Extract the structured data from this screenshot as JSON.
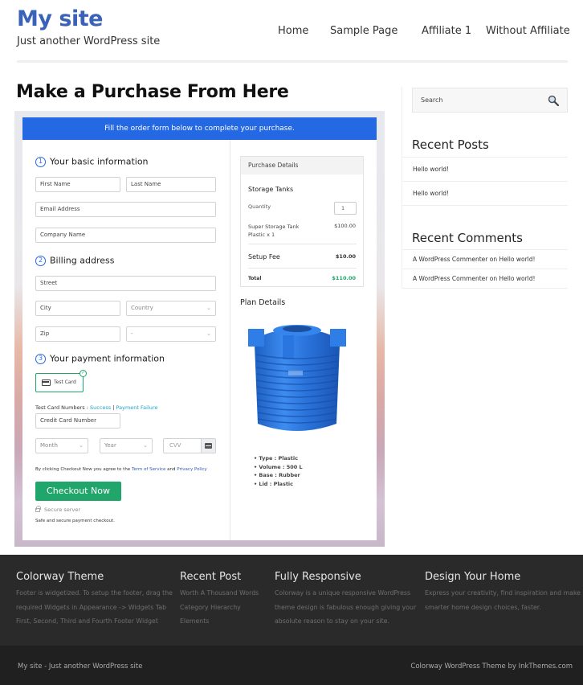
{
  "header": {
    "site_title": "My site",
    "tagline": "Just another WordPress site",
    "nav": [
      "Home",
      "Sample Page",
      "Affiliate 1",
      "Without Affiliate"
    ]
  },
  "main": {
    "page_title": "Make a Purchase From Here",
    "order_form": {
      "banner": "Fill the order form below to complete your purchase.",
      "steps": [
        {
          "num": "1",
          "label": "Your basic information"
        },
        {
          "num": "2",
          "label": "Billing address"
        },
        {
          "num": "3",
          "label": "Your payment information"
        }
      ],
      "fields": {
        "first_name": "First Name",
        "last_name": "Last Name",
        "email": "Email Address",
        "company": "Company Name",
        "street": "Street",
        "city": "City",
        "country": "Country",
        "zip": "Zip",
        "state": "-",
        "card_number": "Credit Card Number",
        "month": "Month",
        "year": "Year",
        "cvv": "CVV"
      },
      "payment_option": "Test Card",
      "test_card_label": "Test Card Numbers :",
      "test_success": "Success",
      "test_sep": "|",
      "test_failure": "Payment Failure",
      "agree_prefix": "By clicking Checkout Now you agree to the",
      "terms": "Term of Service",
      "and": "and",
      "privacy": "Privacy Policy",
      "checkout_button": "Checkout Now",
      "secure_server": "Secure server",
      "safe_text": "Safe and secure payment checkout."
    },
    "purchase_details": {
      "heading": "Purchase Details",
      "product": "Storage Tanks",
      "quantity_label": "Quantity",
      "quantity": "1",
      "item_line1": "Super Storage Tank",
      "item_line2": "Plastic x 1",
      "item_price": "$100.00",
      "setup_fee_label": "Setup Fee",
      "setup_fee": "$10.00",
      "total_label": "Total",
      "total": "$110.00"
    },
    "plan_details": {
      "heading": "Plan Details",
      "specs": [
        "Type : Plastic",
        "Volume : 500 L",
        "Base : Rubber",
        "Lid : Plastic"
      ]
    }
  },
  "sidebar": {
    "search_placeholder": "Search",
    "recent_posts_title": "Recent Posts",
    "recent_posts": [
      "Hello world!",
      "Hello world!"
    ],
    "recent_comments_title": "Recent Comments",
    "recent_comments": [
      "A WordPress Commenter on Hello world!",
      "A WordPress Commenter on Hello world!"
    ]
  },
  "footer": {
    "columns": [
      {
        "title": "Colorway Theme",
        "lines": [
          "Footer is widgetized. To setup the footer, drag the",
          "required Widgets in Appearance -> Widgets Tab",
          "First, Second, Third and Fourth Footer Widget"
        ]
      },
      {
        "title": "Recent Post",
        "lines": [
          "Worth A Thousand Words",
          "Category Hierarchy",
          "Elements"
        ]
      },
      {
        "title": "Fully Responsive",
        "lines": [
          "Colorway is a unique responsive WordPress",
          "theme design is fabulous enough giving your",
          "absolute reason to stay on your site."
        ]
      },
      {
        "title": "Design Your Home",
        "lines": [
          "Express your creativity, find inspiration and make",
          "smarter home design choices, faster."
        ]
      }
    ],
    "copyright_left": "My site - Just another WordPress site",
    "copyright_right": "Colorway WordPress Theme by InkThemes.com"
  },
  "colors": {
    "brand_blue": "#3a62b9",
    "banner_blue": "#2468e4",
    "checkout_green": "#20a66a",
    "footer_bg": "#2a2a2a"
  }
}
